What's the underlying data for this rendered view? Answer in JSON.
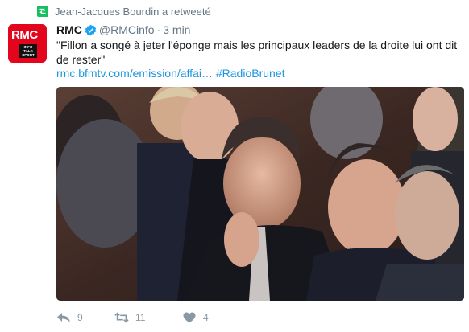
{
  "retweet": {
    "text": "Jean-Jacques Bourdin a retweeté",
    "icon": "retweet-icon"
  },
  "author": {
    "name": "RMC",
    "handle": "@RMCinfo",
    "separator": "·",
    "time": "3 min",
    "avatar": {
      "logo_text": "RMC",
      "tag_text": "INFO TALK SPORT",
      "color": "#e3051b"
    },
    "verified_color": "#1da1f2"
  },
  "tweet": {
    "text": "\"Fillon a songé à jeter l'éponge mais les principaux leaders de la droite lui ont dit de rester\"",
    "link": "rmc.bfmtv.com/emission/affai…",
    "hashtag": "#RadioBrunet",
    "link_color": "#1b95e0"
  },
  "actions": {
    "reply": {
      "icon": "reply-icon",
      "count": "9"
    },
    "retweet": {
      "icon": "retweet-icon",
      "count": "11",
      "color": "#8899a6"
    },
    "like": {
      "icon": "heart-icon",
      "count": "4"
    }
  },
  "colors": {
    "retweet_green": "#17bf63",
    "muted": "#657786"
  }
}
